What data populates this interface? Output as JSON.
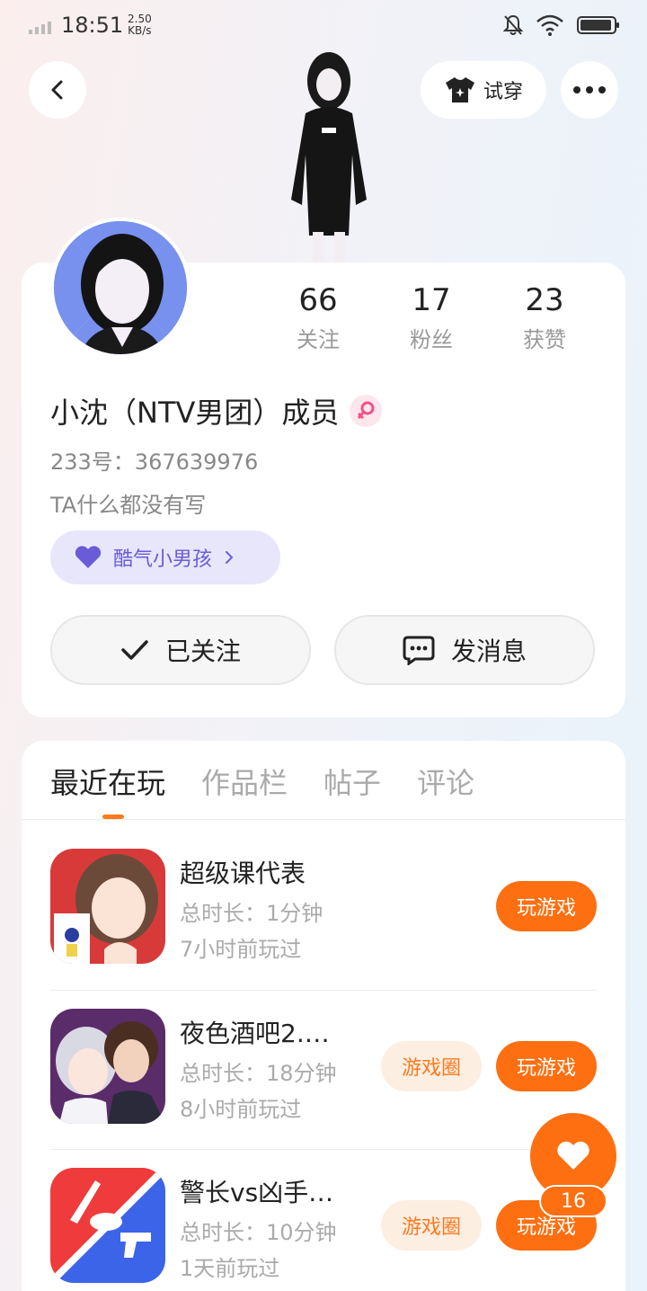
{
  "status_bar": {
    "time": "18:51",
    "speed_value": "2.50",
    "speed_unit": "KB/s",
    "icons": [
      "signal-icon",
      "mute-bell-icon",
      "wifi-icon",
      "battery-icon"
    ]
  },
  "header": {
    "back_icon": "chevron-left-icon",
    "try_on_label": "试穿",
    "try_on_icon": "tshirt-icon",
    "more_icon": "more-dots-icon"
  },
  "profile": {
    "stats": [
      {
        "value": "66",
        "label": "关注"
      },
      {
        "value": "17",
        "label": "粉丝"
      },
      {
        "value": "23",
        "label": "获赞"
      }
    ],
    "nickname": "小沈（NTV男团）成员",
    "gender_icon": "female-icon",
    "uid": "233号：367639976",
    "bio": "TA什么都没有写",
    "tag": {
      "label": "酷气小男孩",
      "icon": "heart-icon"
    },
    "follow_label": "已关注",
    "message_label": "发消息"
  },
  "tabs": [
    {
      "label": "最近在玩",
      "active": true
    },
    {
      "label": "作品栏",
      "active": false
    },
    {
      "label": "帖子",
      "active": false
    },
    {
      "label": "评论",
      "active": false
    }
  ],
  "games": [
    {
      "name": "超级课代表",
      "duration": "总时长：1分钟",
      "last_played": "7小时前玩过",
      "has_circle": false,
      "play_label": "玩游戏"
    },
    {
      "name": "夜色酒吧2.…",
      "duration": "总时长：18分钟",
      "last_played": "8小时前玩过",
      "has_circle": true,
      "circle_label": "游戏圈",
      "play_label": "玩游戏"
    },
    {
      "name": "警长vs凶手…",
      "duration": "总时长：10分钟",
      "last_played": "1天前玩过",
      "has_circle": true,
      "circle_label": "游戏圈",
      "play_label": "玩游戏"
    }
  ],
  "fab": {
    "icon": "heart-icon",
    "count": "16"
  },
  "colors": {
    "accent": "#fd6f10",
    "tag_text": "#6a5cd8",
    "tag_bg": "#e8e6fb"
  }
}
